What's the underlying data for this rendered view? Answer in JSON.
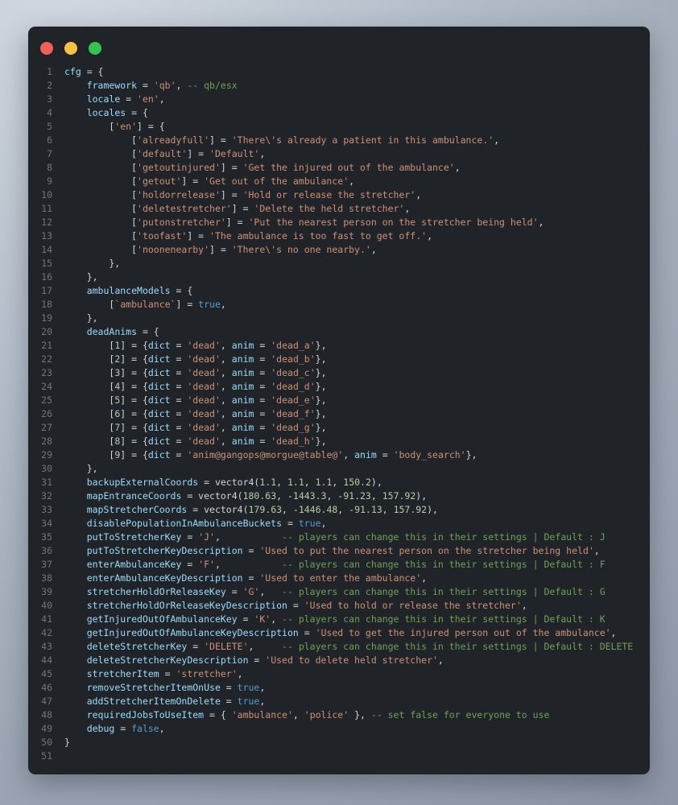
{
  "window": {
    "background": "#202428",
    "traffic_lights": [
      {
        "name": "close",
        "color": "#f1605b"
      },
      {
        "name": "minimize",
        "color": "#f5c144"
      },
      {
        "name": "zoom",
        "color": "#35c24e"
      }
    ]
  },
  "editor": {
    "language": "lua",
    "line_count": 51,
    "line_number_color": "#707579",
    "token_colors": {
      "p": "#d4d4d4",
      "v": "#9cdcfe",
      "s": "#ce9178",
      "c": "#6fa158",
      "n": "#b5cea8",
      "b": "#569cd6"
    },
    "lines": [
      [
        [
          "v",
          "cfg"
        ],
        [
          "p",
          " = {"
        ]
      ],
      [
        [
          "p",
          "    "
        ],
        [
          "v",
          "framework"
        ],
        [
          "p",
          " = "
        ],
        [
          "s",
          "'qb'"
        ],
        [
          "p",
          ", "
        ],
        [
          "c",
          "-- qb/esx"
        ]
      ],
      [
        [
          "p",
          "    "
        ],
        [
          "v",
          "locale"
        ],
        [
          "p",
          " = "
        ],
        [
          "s",
          "'en'"
        ],
        [
          "p",
          ","
        ]
      ],
      [
        [
          "p",
          "    "
        ],
        [
          "v",
          "locales"
        ],
        [
          "p",
          " = {"
        ]
      ],
      [
        [
          "p",
          "        ["
        ],
        [
          "s",
          "'en'"
        ],
        [
          "p",
          "] = {"
        ]
      ],
      [
        [
          "p",
          "            ["
        ],
        [
          "s",
          "'alreadyfull'"
        ],
        [
          "p",
          "] = "
        ],
        [
          "s",
          "'There\\'s already a patient in this ambulance.'"
        ],
        [
          "p",
          ","
        ]
      ],
      [
        [
          "p",
          "            ["
        ],
        [
          "s",
          "'default'"
        ],
        [
          "p",
          "] = "
        ],
        [
          "s",
          "'Default'"
        ],
        [
          "p",
          ","
        ]
      ],
      [
        [
          "p",
          "            ["
        ],
        [
          "s",
          "'getoutinjured'"
        ],
        [
          "p",
          "] = "
        ],
        [
          "s",
          "'Get the injured out of the ambulance'"
        ],
        [
          "p",
          ","
        ]
      ],
      [
        [
          "p",
          "            ["
        ],
        [
          "s",
          "'getout'"
        ],
        [
          "p",
          "] = "
        ],
        [
          "s",
          "'Get out of the ambulance'"
        ],
        [
          "p",
          ","
        ]
      ],
      [
        [
          "p",
          "            ["
        ],
        [
          "s",
          "'holdorrelease'"
        ],
        [
          "p",
          "] = "
        ],
        [
          "s",
          "'Hold or release the stretcher'"
        ],
        [
          "p",
          ","
        ]
      ],
      [
        [
          "p",
          "            ["
        ],
        [
          "s",
          "'deletestretcher'"
        ],
        [
          "p",
          "] = "
        ],
        [
          "s",
          "'Delete the held stretcher'"
        ],
        [
          "p",
          ","
        ]
      ],
      [
        [
          "p",
          "            ["
        ],
        [
          "s",
          "'putonstretcher'"
        ],
        [
          "p",
          "] = "
        ],
        [
          "s",
          "'Put the nearest person on the stretcher being held'"
        ],
        [
          "p",
          ","
        ]
      ],
      [
        [
          "p",
          "            ["
        ],
        [
          "s",
          "'toofast'"
        ],
        [
          "p",
          "] = "
        ],
        [
          "s",
          "'The ambulance is too fast to get off.'"
        ],
        [
          "p",
          ","
        ]
      ],
      [
        [
          "p",
          "            ["
        ],
        [
          "s",
          "'noonenearby'"
        ],
        [
          "p",
          "] = "
        ],
        [
          "s",
          "'There\\'s no one nearby.'"
        ],
        [
          "p",
          ","
        ]
      ],
      [
        [
          "p",
          "        },"
        ]
      ],
      [
        [
          "p",
          "    },"
        ]
      ],
      [
        [
          "p",
          "    "
        ],
        [
          "v",
          "ambulanceModels"
        ],
        [
          "p",
          " = {"
        ]
      ],
      [
        [
          "p",
          "        ["
        ],
        [
          "s",
          "`ambulance`"
        ],
        [
          "p",
          "] = "
        ],
        [
          "b",
          "true"
        ],
        [
          "p",
          ","
        ]
      ],
      [
        [
          "p",
          "    },"
        ]
      ],
      [
        [
          "p",
          "    "
        ],
        [
          "v",
          "deadAnims"
        ],
        [
          "p",
          " = {"
        ]
      ],
      [
        [
          "p",
          "        ["
        ],
        [
          "n",
          "1"
        ],
        [
          "p",
          "] = {"
        ],
        [
          "v",
          "dict"
        ],
        [
          "p",
          " = "
        ],
        [
          "s",
          "'dead'"
        ],
        [
          "p",
          ", "
        ],
        [
          "v",
          "anim"
        ],
        [
          "p",
          " = "
        ],
        [
          "s",
          "'dead_a'"
        ],
        [
          "p",
          "},"
        ]
      ],
      [
        [
          "p",
          "        ["
        ],
        [
          "n",
          "2"
        ],
        [
          "p",
          "] = {"
        ],
        [
          "v",
          "dict"
        ],
        [
          "p",
          " = "
        ],
        [
          "s",
          "'dead'"
        ],
        [
          "p",
          ", "
        ],
        [
          "v",
          "anim"
        ],
        [
          "p",
          " = "
        ],
        [
          "s",
          "'dead_b'"
        ],
        [
          "p",
          "},"
        ]
      ],
      [
        [
          "p",
          "        ["
        ],
        [
          "n",
          "3"
        ],
        [
          "p",
          "] = {"
        ],
        [
          "v",
          "dict"
        ],
        [
          "p",
          " = "
        ],
        [
          "s",
          "'dead'"
        ],
        [
          "p",
          ", "
        ],
        [
          "v",
          "anim"
        ],
        [
          "p",
          " = "
        ],
        [
          "s",
          "'dead_c'"
        ],
        [
          "p",
          "},"
        ]
      ],
      [
        [
          "p",
          "        ["
        ],
        [
          "n",
          "4"
        ],
        [
          "p",
          "] = {"
        ],
        [
          "v",
          "dict"
        ],
        [
          "p",
          " = "
        ],
        [
          "s",
          "'dead'"
        ],
        [
          "p",
          ", "
        ],
        [
          "v",
          "anim"
        ],
        [
          "p",
          " = "
        ],
        [
          "s",
          "'dead_d'"
        ],
        [
          "p",
          "},"
        ]
      ],
      [
        [
          "p",
          "        ["
        ],
        [
          "n",
          "5"
        ],
        [
          "p",
          "] = {"
        ],
        [
          "v",
          "dict"
        ],
        [
          "p",
          " = "
        ],
        [
          "s",
          "'dead'"
        ],
        [
          "p",
          ", "
        ],
        [
          "v",
          "anim"
        ],
        [
          "p",
          " = "
        ],
        [
          "s",
          "'dead_e'"
        ],
        [
          "p",
          "},"
        ]
      ],
      [
        [
          "p",
          "        ["
        ],
        [
          "n",
          "6"
        ],
        [
          "p",
          "] = {"
        ],
        [
          "v",
          "dict"
        ],
        [
          "p",
          " = "
        ],
        [
          "s",
          "'dead'"
        ],
        [
          "p",
          ", "
        ],
        [
          "v",
          "anim"
        ],
        [
          "p",
          " = "
        ],
        [
          "s",
          "'dead_f'"
        ],
        [
          "p",
          "},"
        ]
      ],
      [
        [
          "p",
          "        ["
        ],
        [
          "n",
          "7"
        ],
        [
          "p",
          "] = {"
        ],
        [
          "v",
          "dict"
        ],
        [
          "p",
          " = "
        ],
        [
          "s",
          "'dead'"
        ],
        [
          "p",
          ", "
        ],
        [
          "v",
          "anim"
        ],
        [
          "p",
          " = "
        ],
        [
          "s",
          "'dead_g'"
        ],
        [
          "p",
          "},"
        ]
      ],
      [
        [
          "p",
          "        ["
        ],
        [
          "n",
          "8"
        ],
        [
          "p",
          "] = {"
        ],
        [
          "v",
          "dict"
        ],
        [
          "p",
          " = "
        ],
        [
          "s",
          "'dead'"
        ],
        [
          "p",
          ", "
        ],
        [
          "v",
          "anim"
        ],
        [
          "p",
          " = "
        ],
        [
          "s",
          "'dead_h'"
        ],
        [
          "p",
          "},"
        ]
      ],
      [
        [
          "p",
          "        ["
        ],
        [
          "n",
          "9"
        ],
        [
          "p",
          "] = {"
        ],
        [
          "v",
          "dict"
        ],
        [
          "p",
          " = "
        ],
        [
          "s",
          "'anim@gangops@morgue@table@'"
        ],
        [
          "p",
          ", "
        ],
        [
          "v",
          "anim"
        ],
        [
          "p",
          " = "
        ],
        [
          "s",
          "'body_search'"
        ],
        [
          "p",
          "},"
        ]
      ],
      [
        [
          "p",
          "    },"
        ]
      ],
      [
        [
          "p",
          "    "
        ],
        [
          "v",
          "backupExternalCoords"
        ],
        [
          "p",
          " = vector4("
        ],
        [
          "n",
          "1.1"
        ],
        [
          "p",
          ", "
        ],
        [
          "n",
          "1.1"
        ],
        [
          "p",
          ", "
        ],
        [
          "n",
          "1.1"
        ],
        [
          "p",
          ", "
        ],
        [
          "n",
          "150.2"
        ],
        [
          "p",
          "),"
        ]
      ],
      [
        [
          "p",
          "    "
        ],
        [
          "v",
          "mapEntranceCoords"
        ],
        [
          "p",
          " = vector4("
        ],
        [
          "n",
          "180.63"
        ],
        [
          "p",
          ", -"
        ],
        [
          "n",
          "1443.3"
        ],
        [
          "p",
          ", -"
        ],
        [
          "n",
          "91.23"
        ],
        [
          "p",
          ", "
        ],
        [
          "n",
          "157.92"
        ],
        [
          "p",
          "),"
        ]
      ],
      [
        [
          "p",
          "    "
        ],
        [
          "v",
          "mapStretcherCoords"
        ],
        [
          "p",
          " = vector4("
        ],
        [
          "n",
          "179.63"
        ],
        [
          "p",
          ", -"
        ],
        [
          "n",
          "1446.48"
        ],
        [
          "p",
          ", -"
        ],
        [
          "n",
          "91.13"
        ],
        [
          "p",
          ", "
        ],
        [
          "n",
          "157.92"
        ],
        [
          "p",
          "),"
        ]
      ],
      [
        [
          "p",
          "    "
        ],
        [
          "v",
          "disablePopulationInAmbulanceBuckets"
        ],
        [
          "p",
          " = "
        ],
        [
          "b",
          "true"
        ],
        [
          "p",
          ","
        ]
      ],
      [
        [
          "p",
          "    "
        ],
        [
          "v",
          "putToStretcherKey"
        ],
        [
          "p",
          " = "
        ],
        [
          "s",
          "'J'"
        ],
        [
          "p",
          ",           "
        ],
        [
          "c",
          "-- players can change this in their settings | Default : J"
        ]
      ],
      [
        [
          "p",
          "    "
        ],
        [
          "v",
          "putToStretcherKeyDescription"
        ],
        [
          "p",
          " = "
        ],
        [
          "s",
          "'Used to put the nearest person on the stretcher being held'"
        ],
        [
          "p",
          ","
        ]
      ],
      [
        [
          "p",
          "    "
        ],
        [
          "v",
          "enterAmbulanceKey"
        ],
        [
          "p",
          " = "
        ],
        [
          "s",
          "'F'"
        ],
        [
          "p",
          ",           "
        ],
        [
          "c",
          "-- players can change this in their settings | Default : F"
        ]
      ],
      [
        [
          "p",
          "    "
        ],
        [
          "v",
          "enterAmbulanceKeyDescription"
        ],
        [
          "p",
          " = "
        ],
        [
          "s",
          "'Used to enter the ambulance'"
        ],
        [
          "p",
          ","
        ]
      ],
      [
        [
          "p",
          "    "
        ],
        [
          "v",
          "stretcherHoldOrReleaseKey"
        ],
        [
          "p",
          " = "
        ],
        [
          "s",
          "'G'"
        ],
        [
          "p",
          ",   "
        ],
        [
          "c",
          "-- players can change this in their settings | Default : G"
        ]
      ],
      [
        [
          "p",
          "    "
        ],
        [
          "v",
          "stretcherHoldOrReleaseKeyDescription"
        ],
        [
          "p",
          " = "
        ],
        [
          "s",
          "'Used to hold or release the stretcher'"
        ],
        [
          "p",
          ","
        ]
      ],
      [
        [
          "p",
          "    "
        ],
        [
          "v",
          "getInjuredOutOfAmbulanceKey"
        ],
        [
          "p",
          " = "
        ],
        [
          "s",
          "'K'"
        ],
        [
          "p",
          ", "
        ],
        [
          "c",
          "-- players can change this in their settings | Default : K"
        ]
      ],
      [
        [
          "p",
          "    "
        ],
        [
          "v",
          "getInjuredOutOfAmbulanceKeyDescription"
        ],
        [
          "p",
          " = "
        ],
        [
          "s",
          "'Used to get the injured person out of the ambulance'"
        ],
        [
          "p",
          ","
        ]
      ],
      [
        [
          "p",
          "    "
        ],
        [
          "v",
          "deleteStretcherKey"
        ],
        [
          "p",
          " = "
        ],
        [
          "s",
          "'DELETE'"
        ],
        [
          "p",
          ",     "
        ],
        [
          "c",
          "-- players can change this in their settings | Default : DELETE"
        ]
      ],
      [
        [
          "p",
          "    "
        ],
        [
          "v",
          "deleteStretcherKeyDescription"
        ],
        [
          "p",
          " = "
        ],
        [
          "s",
          "'Used to delete held stretcher'"
        ],
        [
          "p",
          ","
        ]
      ],
      [
        [
          "p",
          "    "
        ],
        [
          "v",
          "stretcherItem"
        ],
        [
          "p",
          " = "
        ],
        [
          "s",
          "'stretcher'"
        ],
        [
          "p",
          ","
        ]
      ],
      [
        [
          "p",
          "    "
        ],
        [
          "v",
          "removeStretcherItemOnUse"
        ],
        [
          "p",
          " = "
        ],
        [
          "b",
          "true"
        ],
        [
          "p",
          ","
        ]
      ],
      [
        [
          "p",
          "    "
        ],
        [
          "v",
          "addStretcherItemOnDelete"
        ],
        [
          "p",
          " = "
        ],
        [
          "b",
          "true"
        ],
        [
          "p",
          ","
        ]
      ],
      [
        [
          "p",
          "    "
        ],
        [
          "v",
          "requiredJobsToUseItem"
        ],
        [
          "p",
          " = { "
        ],
        [
          "s",
          "'ambulance'"
        ],
        [
          "p",
          ", "
        ],
        [
          "s",
          "'police'"
        ],
        [
          "p",
          " }, "
        ],
        [
          "c",
          "-- set false for everyone to use"
        ]
      ],
      [
        [
          "p",
          "    "
        ],
        [
          "v",
          "debug"
        ],
        [
          "p",
          " = "
        ],
        [
          "b",
          "false"
        ],
        [
          "p",
          ","
        ]
      ],
      [
        [
          "p",
          "}"
        ]
      ],
      []
    ]
  }
}
